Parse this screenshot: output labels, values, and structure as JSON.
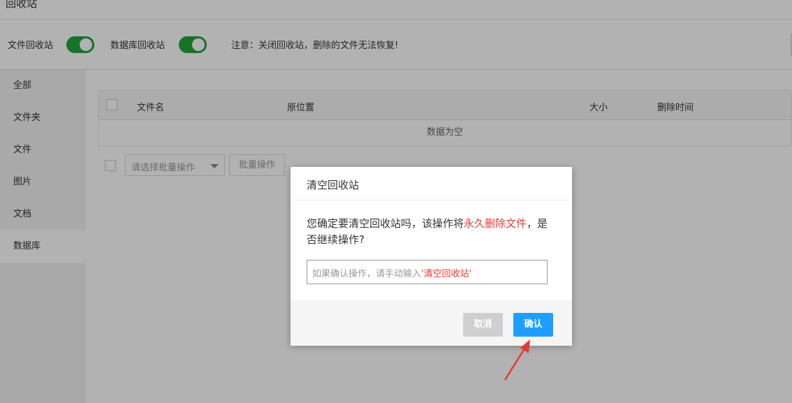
{
  "page": {
    "title": "回收站"
  },
  "toolbar": {
    "file_recycle_label": "文件回收站",
    "file_recycle_enabled": true,
    "db_recycle_label": "数据库回收站",
    "db_recycle_enabled": true,
    "notice": "注意：关闭回收站，删除的文件无法恢复!"
  },
  "sidebar": {
    "items": [
      {
        "label": "全部"
      },
      {
        "label": "文件夹"
      },
      {
        "label": "文件"
      },
      {
        "label": "图片"
      },
      {
        "label": "文档"
      },
      {
        "label": "数据库",
        "active": true
      }
    ]
  },
  "table": {
    "columns": [
      "文件名",
      "原位置",
      "大小",
      "删除时间"
    ],
    "empty_text": "数据为空"
  },
  "batch": {
    "select_placeholder": "请选择批量操作",
    "button_label": "批量操作"
  },
  "modal": {
    "title": "清空回收站",
    "message_prefix": "您确定要清空回收站吗，该操作将",
    "message_danger": "永久删除文件",
    "message_suffix": "，是否继续操作?",
    "input_placeholder_prefix": "如果确认操作，请手动输入",
    "input_placeholder_keyword": "'清空回收站'",
    "cancel_label": "取消",
    "confirm_label": "确认"
  },
  "colors": {
    "toggle_on": "#20a53a",
    "primary": "#1e9fff",
    "danger": "#e53935",
    "cancel_btn": "#cfcfcf"
  }
}
